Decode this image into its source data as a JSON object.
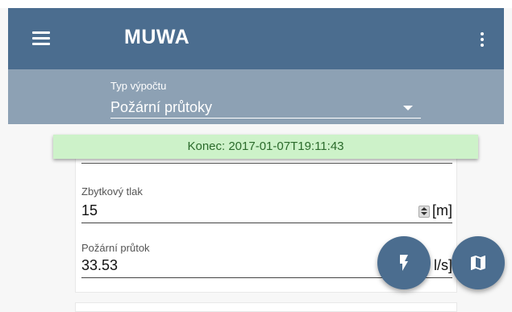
{
  "app": {
    "title": "MUWA"
  },
  "calculation": {
    "label": "Typ výpočtu",
    "selected": "Požární průtoky"
  },
  "status": {
    "text": "Konec: 2017-01-07T19:11:43",
    "color": "#cdf2c9"
  },
  "fields": [
    {
      "label": "Zbytkový tlak",
      "value": "15",
      "unit": "[m]"
    },
    {
      "label": "Požární průtok",
      "value": "33.53",
      "unit": "l/s]"
    }
  ],
  "icons": {
    "menu": "menu-icon",
    "more": "more-vert-icon",
    "calculate": "flash-icon",
    "map": "map-icon"
  },
  "colors": {
    "primary": "#4b6d8f",
    "secondary": "#8da1b4"
  }
}
